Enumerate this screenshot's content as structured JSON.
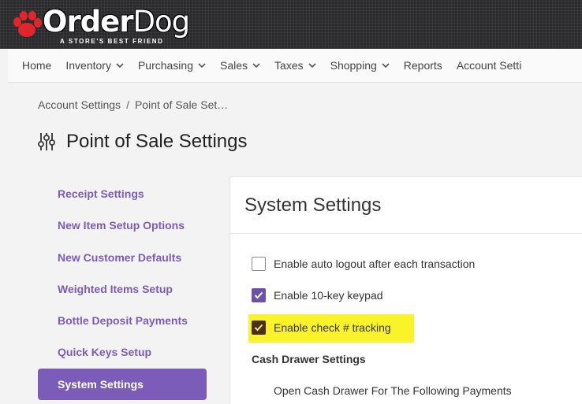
{
  "header": {
    "logo_bold": "Order",
    "logo_light": "Dog",
    "tagline": "A STORE'S BEST FRIEND"
  },
  "nav": {
    "items": [
      {
        "label": "Home",
        "dropdown": false
      },
      {
        "label": "Inventory",
        "dropdown": true
      },
      {
        "label": "Purchasing",
        "dropdown": true
      },
      {
        "label": "Sales",
        "dropdown": true
      },
      {
        "label": "Taxes",
        "dropdown": true
      },
      {
        "label": "Shopping",
        "dropdown": true
      },
      {
        "label": "Reports",
        "dropdown": false
      },
      {
        "label": "Account Setti",
        "dropdown": false
      }
    ]
  },
  "breadcrumb": {
    "parent": "Account Settings",
    "separator": "/",
    "current": "Point of Sale Set…"
  },
  "page": {
    "title": "Point of Sale Settings"
  },
  "sidebar": {
    "items": [
      {
        "label": "Receipt Settings"
      },
      {
        "label": "New Item Setup Options"
      },
      {
        "label": "New Customer Defaults"
      },
      {
        "label": "Weighted Items Setup"
      },
      {
        "label": "Bottle Deposit Payments"
      },
      {
        "label": "Quick Keys Setup"
      },
      {
        "label": "System Settings",
        "active": true
      }
    ]
  },
  "system_settings": {
    "title": "System Settings",
    "options": [
      {
        "label": "Enable auto logout after each transaction",
        "checked": false
      },
      {
        "label": "Enable 10-key keypad",
        "checked": true
      },
      {
        "label": "Enable check # tracking",
        "checked": true,
        "highlighted": true
      }
    ],
    "cash_drawer_heading": "Cash Drawer Settings",
    "cash_drawer_subheading": "Open Cash Drawer For The Following Payments"
  },
  "colors": {
    "accent": "#7b5cb8",
    "checkbox_checked": "#6b52a8",
    "highlight": "#fbf32a",
    "header_bg": "#2b2b2e",
    "paw": "#e0262b"
  }
}
